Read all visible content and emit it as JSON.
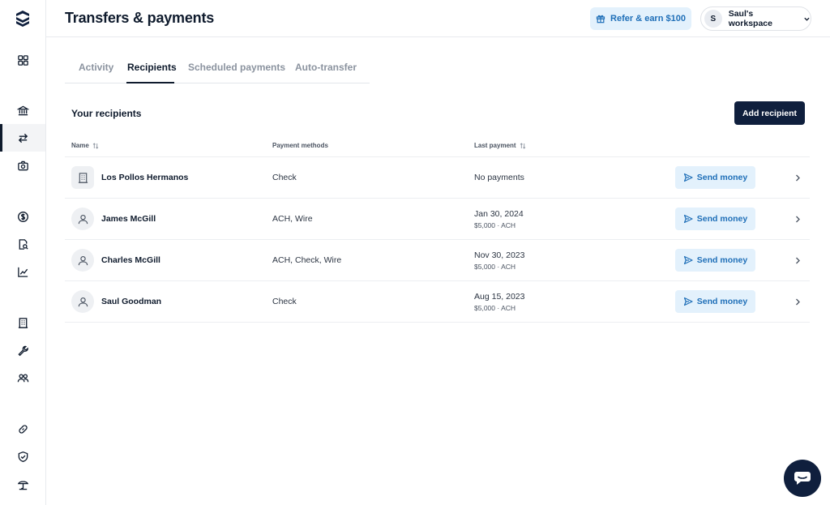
{
  "header": {
    "title": "Transfers & payments",
    "refer_label": "Refer & earn $100",
    "workspace": {
      "initial": "S",
      "name": "Saul's workspace"
    }
  },
  "sidebar": {
    "items": [
      {
        "icon": "grid-icon",
        "active": false
      },
      {
        "icon": "bank-icon",
        "active": false
      },
      {
        "icon": "transfer-arrows-icon",
        "active": true
      },
      {
        "icon": "camera-icon",
        "active": false
      },
      {
        "icon": "dollar-circle-icon",
        "active": false
      },
      {
        "icon": "document-search-icon",
        "active": false
      },
      {
        "icon": "chart-line-icon",
        "active": false
      },
      {
        "icon": "building-icon",
        "active": false
      },
      {
        "icon": "wrench-icon",
        "active": false
      },
      {
        "icon": "users-icon",
        "active": false
      },
      {
        "icon": "link-icon",
        "active": false
      },
      {
        "icon": "shield-check-icon",
        "active": false
      },
      {
        "icon": "umbrella-icon",
        "active": false
      }
    ]
  },
  "tabs": [
    {
      "label": "Activity",
      "active": false
    },
    {
      "label": "Recipients",
      "active": true
    },
    {
      "label": "Scheduled payments",
      "active": false
    },
    {
      "label": "Auto-transfer",
      "active": false
    }
  ],
  "recipients": {
    "title": "Your recipients",
    "add_label": "Add recipient",
    "columns": {
      "name": "Name",
      "methods": "Payment methods",
      "last": "Last payment"
    },
    "send_label": "Send money",
    "rows": [
      {
        "name": "Los Pollos Hermanos",
        "type": "business",
        "methods": "Check",
        "last": "No payments",
        "sub": ""
      },
      {
        "name": "James McGill",
        "type": "person",
        "methods": "ACH, Wire",
        "last": "Jan 30, 2024",
        "sub": "$5,000 · ACH"
      },
      {
        "name": "Charles McGill",
        "type": "person",
        "methods": "ACH, Check, Wire",
        "last": "Nov 30, 2023",
        "sub": "$5,000 · ACH"
      },
      {
        "name": "Saul Goodman",
        "type": "person",
        "methods": "Check",
        "last": "Aug 15, 2023",
        "sub": "$5,000 · ACH"
      }
    ]
  },
  "colors": {
    "primary_dark": "#0f1f3d",
    "accent_blue": "#1f6fb8",
    "accent_bg": "#e3f1fc"
  }
}
